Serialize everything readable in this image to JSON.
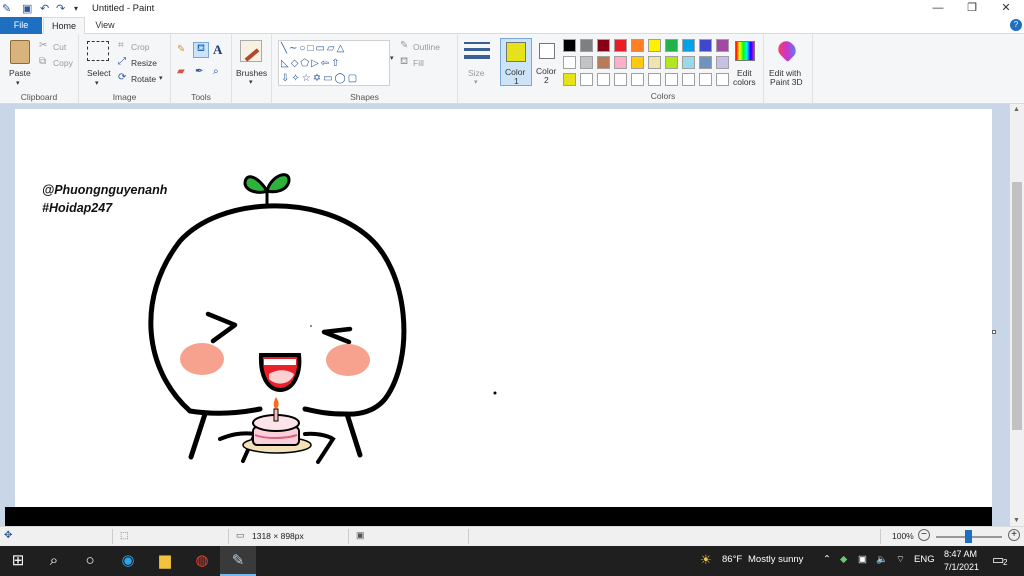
{
  "window": {
    "title": "Untitled - Paint",
    "controls": [
      "minimize-icon",
      "restore-icon",
      "close-icon"
    ]
  },
  "tabs": [
    {
      "label": "File",
      "active": false
    },
    {
      "label": "Home",
      "active": true
    },
    {
      "label": "View",
      "active": false
    }
  ],
  "ribbon": {
    "clipboard": {
      "paste": "Paste",
      "cut": "Cut",
      "copy": "Copy",
      "group": "Clipboard"
    },
    "image": {
      "select": "Select",
      "crop": "Crop",
      "resize": "Resize",
      "rotate": "Rotate",
      "group": "Image"
    },
    "tools": {
      "group": "Tools"
    },
    "brushes": {
      "label": "Brushes"
    },
    "shapes": {
      "outline": "Outline",
      "fill": "Fill",
      "group": "Shapes"
    },
    "size": {
      "label": "Size"
    },
    "color1": {
      "label": "Color",
      "num": "1",
      "value": "#e6e21a"
    },
    "color2": {
      "label": "Color",
      "num": "2",
      "value": "#ffffff"
    },
    "edit_colors": {
      "line1": "Edit",
      "line2": "colors"
    },
    "colors_group": "Colors",
    "paint3d": {
      "line1": "Edit with",
      "line2": "Paint 3D"
    },
    "palette_row1": [
      "#000000",
      "#7f7f7f",
      "#880015",
      "#ed1c24",
      "#ff7f27",
      "#fff200",
      "#22b14c",
      "#00a2e8",
      "#3f48cc",
      "#a349a4"
    ],
    "palette_row2": [
      "#ffffff",
      "#c3c3c3",
      "#b97a57",
      "#ffaec9",
      "#ffc90e",
      "#efe4b0",
      "#b5e61d",
      "#99d9ea",
      "#7092be",
      "#c8bfe7"
    ],
    "palette_row3": [
      "#e6e21a",
      "#ffffff",
      "#ffffff",
      "#ffffff",
      "#ffffff",
      "#ffffff",
      "#ffffff",
      "#ffffff",
      "#ffffff",
      "#ffffff"
    ]
  },
  "canvas": {
    "watermark_line1": "@Phuongnguyenanh",
    "watermark_line2": "#Hoidap247"
  },
  "status": {
    "image_size": "1318 × 898px",
    "zoom": "100%"
  },
  "taskbar": {
    "weather_temp": "86°F",
    "weather_desc": "Mostly sunny",
    "language": "ENG",
    "time": "8:47 AM",
    "date": "7/1/2021",
    "notifications": "2"
  }
}
